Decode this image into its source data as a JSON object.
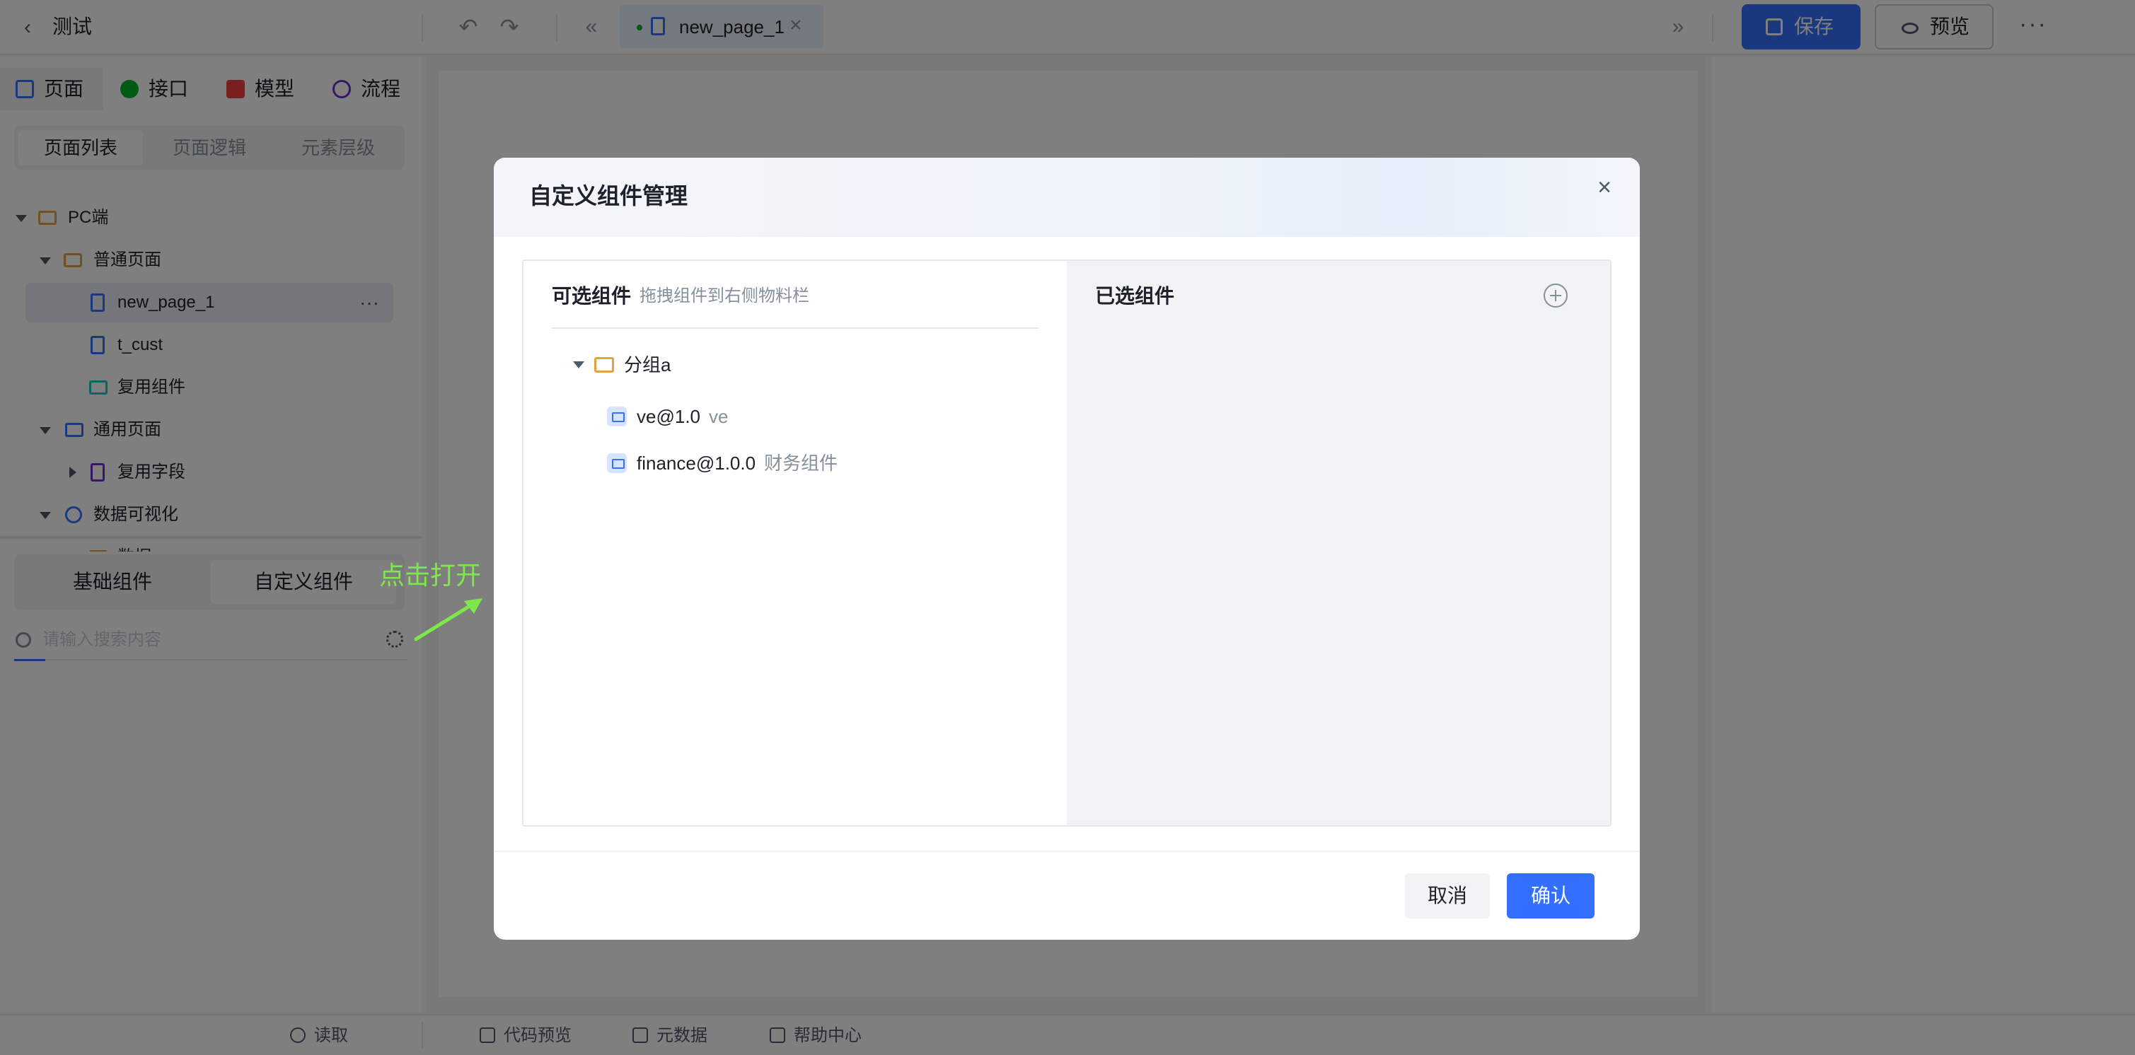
{
  "header": {
    "back_icon": "chevron-left-icon",
    "title": "测试",
    "undo_icon": "undo-icon",
    "redo_icon": "redo-icon",
    "prev_icon": "double-chevron-left-icon",
    "next_icon": "double-chevron-right-icon",
    "tab": {
      "label": "new_page_1",
      "status_color": "#00b42a"
    },
    "save_label": "保存",
    "preview_label": "预览",
    "more_icon": "more-icon",
    "accent_color": "#3370ff"
  },
  "sidebar": {
    "tabs": [
      {
        "label": "页面",
        "icon": "page-icon",
        "color": "#3370ff"
      },
      {
        "label": "接口",
        "icon": "api-icon",
        "color": "#00b42a"
      },
      {
        "label": "模型",
        "icon": "model-icon",
        "color": "#f53f3f"
      },
      {
        "label": "流程",
        "icon": "flow-icon",
        "color": "#722ed1"
      }
    ],
    "segments": [
      "页面列表",
      "页面逻辑",
      "元素层级"
    ],
    "tree": [
      {
        "label": "PC端"
      },
      {
        "label": "普通页面"
      },
      {
        "label": "new_page_1"
      },
      {
        "label": "t_cust"
      },
      {
        "label": "复用组件"
      },
      {
        "label": "通用页面"
      },
      {
        "label": "复用字段"
      },
      {
        "label": "数据可视化"
      },
      {
        "label": "数据"
      }
    ],
    "component_tabs": [
      "基础组件",
      "自定义组件"
    ],
    "search_placeholder": "请输入搜索内容"
  },
  "annotation": {
    "text": "点击打开",
    "color": "#7ee84a"
  },
  "dialog": {
    "title": "自定义组件管理",
    "available": {
      "title": "可选组件",
      "subtitle": "拖拽组件到右侧物料栏",
      "group": "分组a",
      "items": [
        {
          "name": "ve@1.0",
          "desc": "ve"
        },
        {
          "name": "finance@1.0.0",
          "desc": "财务组件"
        }
      ]
    },
    "selected": {
      "title": "已选组件"
    },
    "cancel_label": "取消",
    "confirm_label": "确认"
  },
  "footer": {
    "items": [
      "读取",
      "代码预览",
      "元数据",
      "帮助中心"
    ]
  }
}
